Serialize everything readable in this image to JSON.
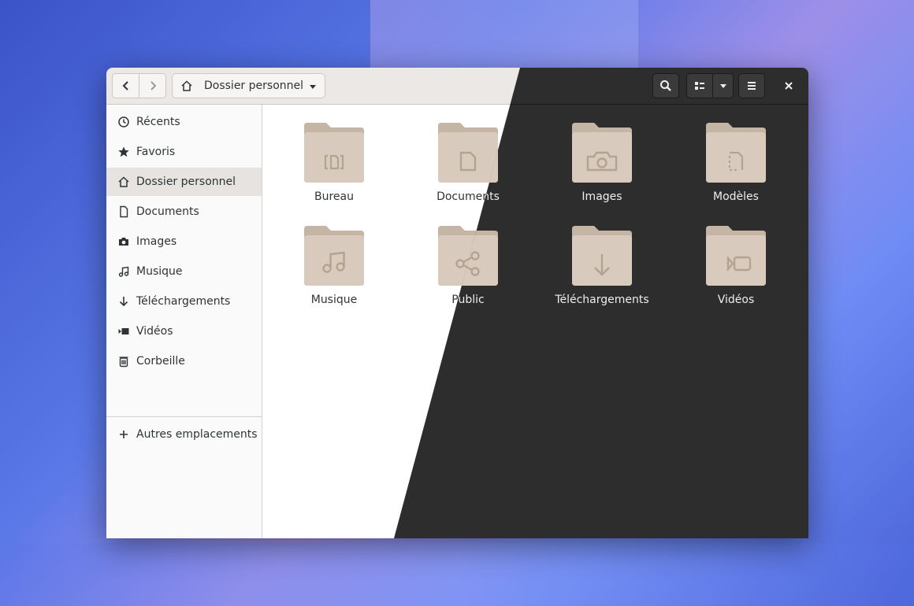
{
  "window": {
    "path_bar": {
      "label": "Dossier personnel"
    }
  },
  "icons": {
    "back": "go-previous-icon",
    "forward": "go-next-icon",
    "home": "home-icon",
    "search": "search-icon",
    "view": "list-view-icon",
    "menu": "hamburger-menu-icon",
    "close": "close-icon"
  },
  "sidebar": {
    "items": [
      {
        "label": "Récents",
        "icon": "clock-icon"
      },
      {
        "label": "Favoris",
        "icon": "star-icon"
      },
      {
        "label": "Dossier personnel",
        "icon": "home-icon",
        "active": true
      },
      {
        "label": "Documents",
        "icon": "document-icon"
      },
      {
        "label": "Images",
        "icon": "camera-icon"
      },
      {
        "label": "Musique",
        "icon": "music-icon"
      },
      {
        "label": "Téléchargements",
        "icon": "download-icon"
      },
      {
        "label": "Vidéos",
        "icon": "video-icon"
      },
      {
        "label": "Corbeille",
        "icon": "trash-icon"
      }
    ],
    "other_locations": {
      "label": "Autres emplacements",
      "icon": "plus-icon"
    }
  },
  "folders": [
    {
      "label": "Bureau",
      "icon": "desktop-folder-icon"
    },
    {
      "label": "Documents",
      "icon": "documents-folder-icon"
    },
    {
      "label": "Images",
      "icon": "pictures-folder-icon"
    },
    {
      "label": "Modèles",
      "icon": "templates-folder-icon"
    },
    {
      "label": "Musique",
      "icon": "music-folder-icon"
    },
    {
      "label": "Public",
      "icon": "public-share-folder-icon"
    },
    {
      "label": "Téléchargements",
      "icon": "downloads-folder-icon"
    },
    {
      "label": "Vidéos",
      "icon": "videos-folder-icon"
    }
  ],
  "colors": {
    "folder_fill": "#d8cbbd",
    "folder_tab": "#c4b5a5",
    "folder_glyph": "#b4a390",
    "dark_surface": "#2d2d2d",
    "light_surface": "#ffffff"
  }
}
